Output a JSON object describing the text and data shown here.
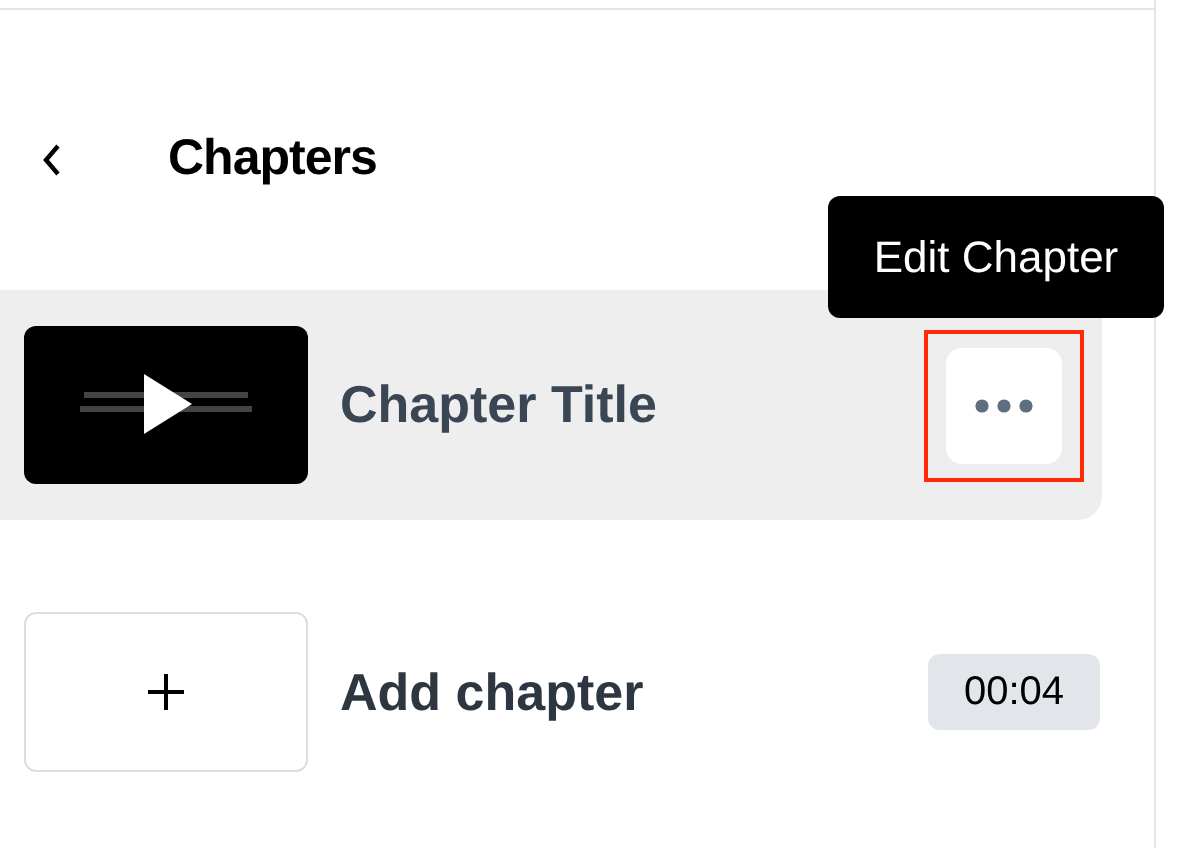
{
  "header": {
    "title": "Chapters"
  },
  "chapters": [
    {
      "title": "Chapter Title",
      "selected": true,
      "menu_highlighted": true
    }
  ],
  "tooltip": {
    "text": "Edit Chapter"
  },
  "add_chapter": {
    "label": "Add chapter",
    "duration": "00:04"
  }
}
